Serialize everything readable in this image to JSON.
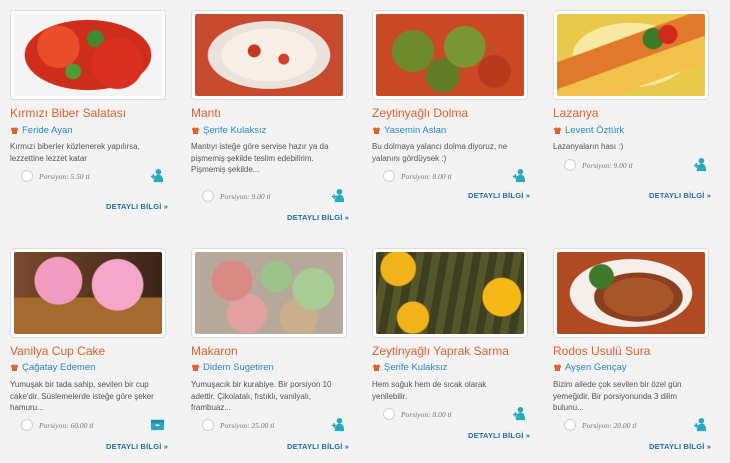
{
  "colors": {
    "title": "#e0622e",
    "author": "#2a8ac2",
    "link": "#1f6fa8",
    "icon": "#28a9c0"
  },
  "detail_label": "DETAYLI BİLGİ »",
  "recipes": [
    {
      "title": "Kırmızı Biber Salatası",
      "author": "Feride Ayan",
      "description": "Kırmızı biberler közlenerek yapılırsa, lezzettine lezzet katar",
      "portion": "Porsiyon: 5.50 tl",
      "icon": "person-add-icon"
    },
    {
      "title": "Mantı",
      "author": "Şerife Kulaksız",
      "description": "Mantıyı isteğe göre servise hazır ya da pişmemiş şekilde teslim edebilirim. Pişmemiş şekilde...",
      "portion": "Porsiyon: 9.00 tl",
      "icon": "person-add-icon"
    },
    {
      "title": "Zeytinyağlı Dolma",
      "author": "Yasemin Aslan",
      "description": "Bu dolmaya yalancı dolma diyoruz, ne yalanını gördüysek :)",
      "portion": "Porsiyon: 8.00 tl",
      "icon": "person-add-icon"
    },
    {
      "title": "Lazanya",
      "author": "Levent Öztürk",
      "description": "Lazanyaların hası :)",
      "portion": "Porsiyon: 9.00 tl",
      "icon": "person-add-icon"
    },
    {
      "title": "Vanilya Cup Cake",
      "author": "Çağatay Edemen",
      "description": "Yumuşak bir tada sahip, sevilen bir cup cake'dir. Süslemelerde isteğe göre şeker hamuru...",
      "portion": "Porsiyon: 60.00 tl",
      "icon": "box-icon"
    },
    {
      "title": "Makaron",
      "author": "Didem Sugetiren",
      "description": "Yumuşacık bir kurabiye. Bir porsiyon 10 adettir. Çikolatalı, fıstıklı, vanilyalı, frambuaz...",
      "portion": "Porsiyon: 25.00 tl",
      "icon": "person-add-icon"
    },
    {
      "title": "Zeytinyağlı Yaprak Sarma",
      "author": "Şerife Kulaksız",
      "description": "Hem soğuk hem de sıcak olarak yenilebilir.",
      "portion": "Porsiyon: 8.00 tl",
      "icon": "person-add-icon"
    },
    {
      "title": "Rodos Usulü Sura",
      "author": "Ayşen Gençay",
      "description": "Bizim ailede çok sevilen bir özel gün yemeğidir. Bir porsiyonunda 3 dilim bulunu...",
      "portion": "Porsiyon: 20.00 tl",
      "icon": "person-add-icon"
    }
  ]
}
